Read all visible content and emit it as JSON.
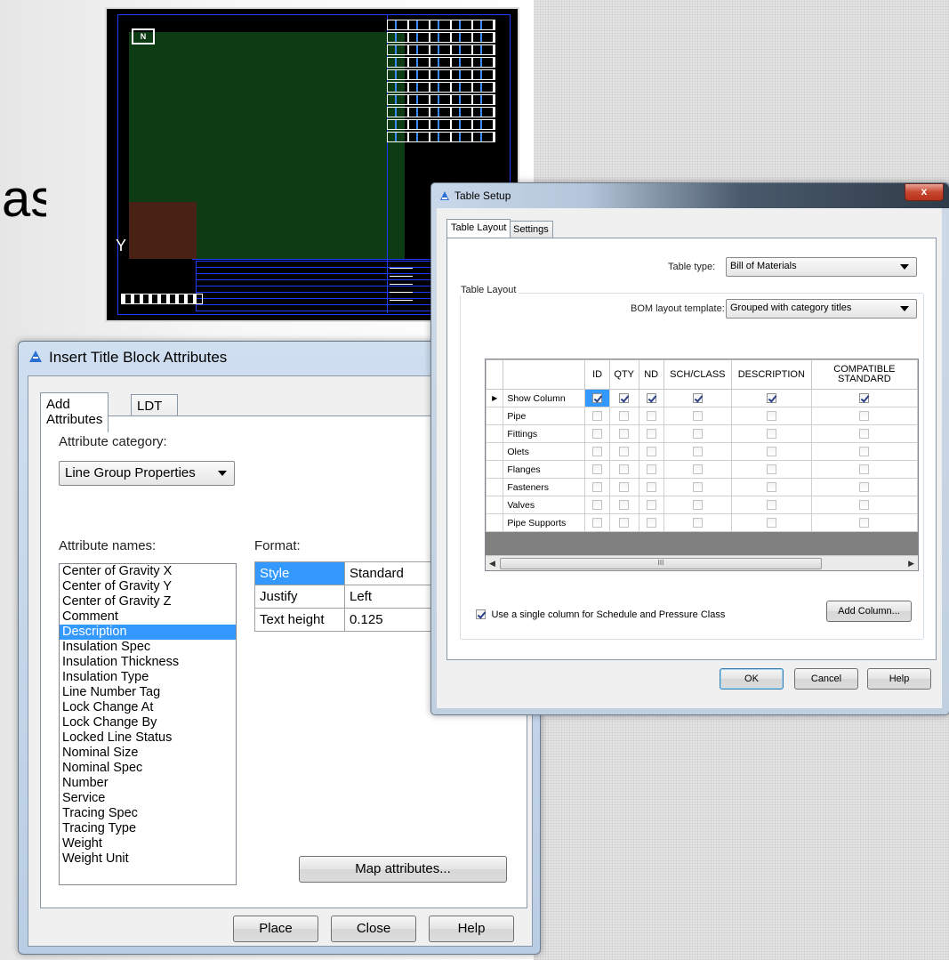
{
  "slide_text_fragment": "as",
  "insert_dialog": {
    "title": "Insert Title Block Attributes",
    "tabs": [
      "Add Attributes",
      "LDT Setup"
    ],
    "category_label": "Attribute category:",
    "category_value": "Line Group Properties",
    "names_label": "Attribute names:",
    "attribute_names": [
      "Center of Gravity X",
      "Center of Gravity Y",
      "Center of Gravity Z",
      "Comment",
      "Description",
      "Insulation Spec",
      "Insulation Thickness",
      "Insulation Type",
      "Line Number Tag",
      "Lock Change At",
      "Lock Change By",
      "Locked Line Status",
      "Nominal Size",
      "Nominal Spec",
      "Number",
      "Service",
      "Tracing Spec",
      "Tracing Type",
      "Weight",
      "Weight Unit"
    ],
    "selected_attribute": "Description",
    "format_label": "Format:",
    "format_rows": [
      {
        "key": "Style",
        "value": "Standard"
      },
      {
        "key": "Justify",
        "value": "Left"
      },
      {
        "key": "Text height",
        "value": "0.125"
      }
    ],
    "map_button": "Map attributes...",
    "buttons": {
      "place": "Place",
      "close": "Close",
      "help": "Help"
    }
  },
  "table_setup": {
    "title": "Table Setup",
    "close_glyph": "x",
    "tabs": [
      "Table Layout",
      "Settings"
    ],
    "table_type_label": "Table type:",
    "table_type_value": "Bill of Materials",
    "group_label": "Table Layout",
    "template_label": "BOM layout template:",
    "template_value": "Grouped with category titles",
    "columns": [
      "ID",
      "QTY",
      "ND",
      "SCH/CLASS",
      "DESCRIPTION",
      "COMPATIBLE STANDARD"
    ],
    "rows": [
      {
        "name": "Show Column",
        "checks": [
          true,
          true,
          true,
          true,
          true,
          true
        ],
        "current": true
      },
      {
        "name": "Pipe",
        "checks": [
          false,
          false,
          false,
          false,
          false,
          false
        ]
      },
      {
        "name": "Fittings",
        "checks": [
          false,
          false,
          false,
          false,
          false,
          false
        ]
      },
      {
        "name": "Olets",
        "checks": [
          false,
          false,
          false,
          false,
          false,
          false
        ]
      },
      {
        "name": "Flanges",
        "checks": [
          false,
          false,
          false,
          false,
          false,
          false
        ]
      },
      {
        "name": "Fasteners",
        "checks": [
          false,
          false,
          false,
          false,
          false,
          false
        ]
      },
      {
        "name": "Valves",
        "checks": [
          false,
          false,
          false,
          false,
          false,
          false
        ]
      },
      {
        "name": "Pipe Supports",
        "checks": [
          false,
          false,
          false,
          false,
          false,
          false
        ]
      }
    ],
    "scroll_glyph": "III",
    "single_column_label": "Use a single column for Schedule and Pressure Class",
    "single_column_checked": true,
    "add_column_button": "Add Column...",
    "buttons": {
      "ok": "OK",
      "cancel": "Cancel",
      "help": "Help"
    }
  },
  "cad": {
    "logo_text": "N",
    "axis_text": "Y"
  }
}
